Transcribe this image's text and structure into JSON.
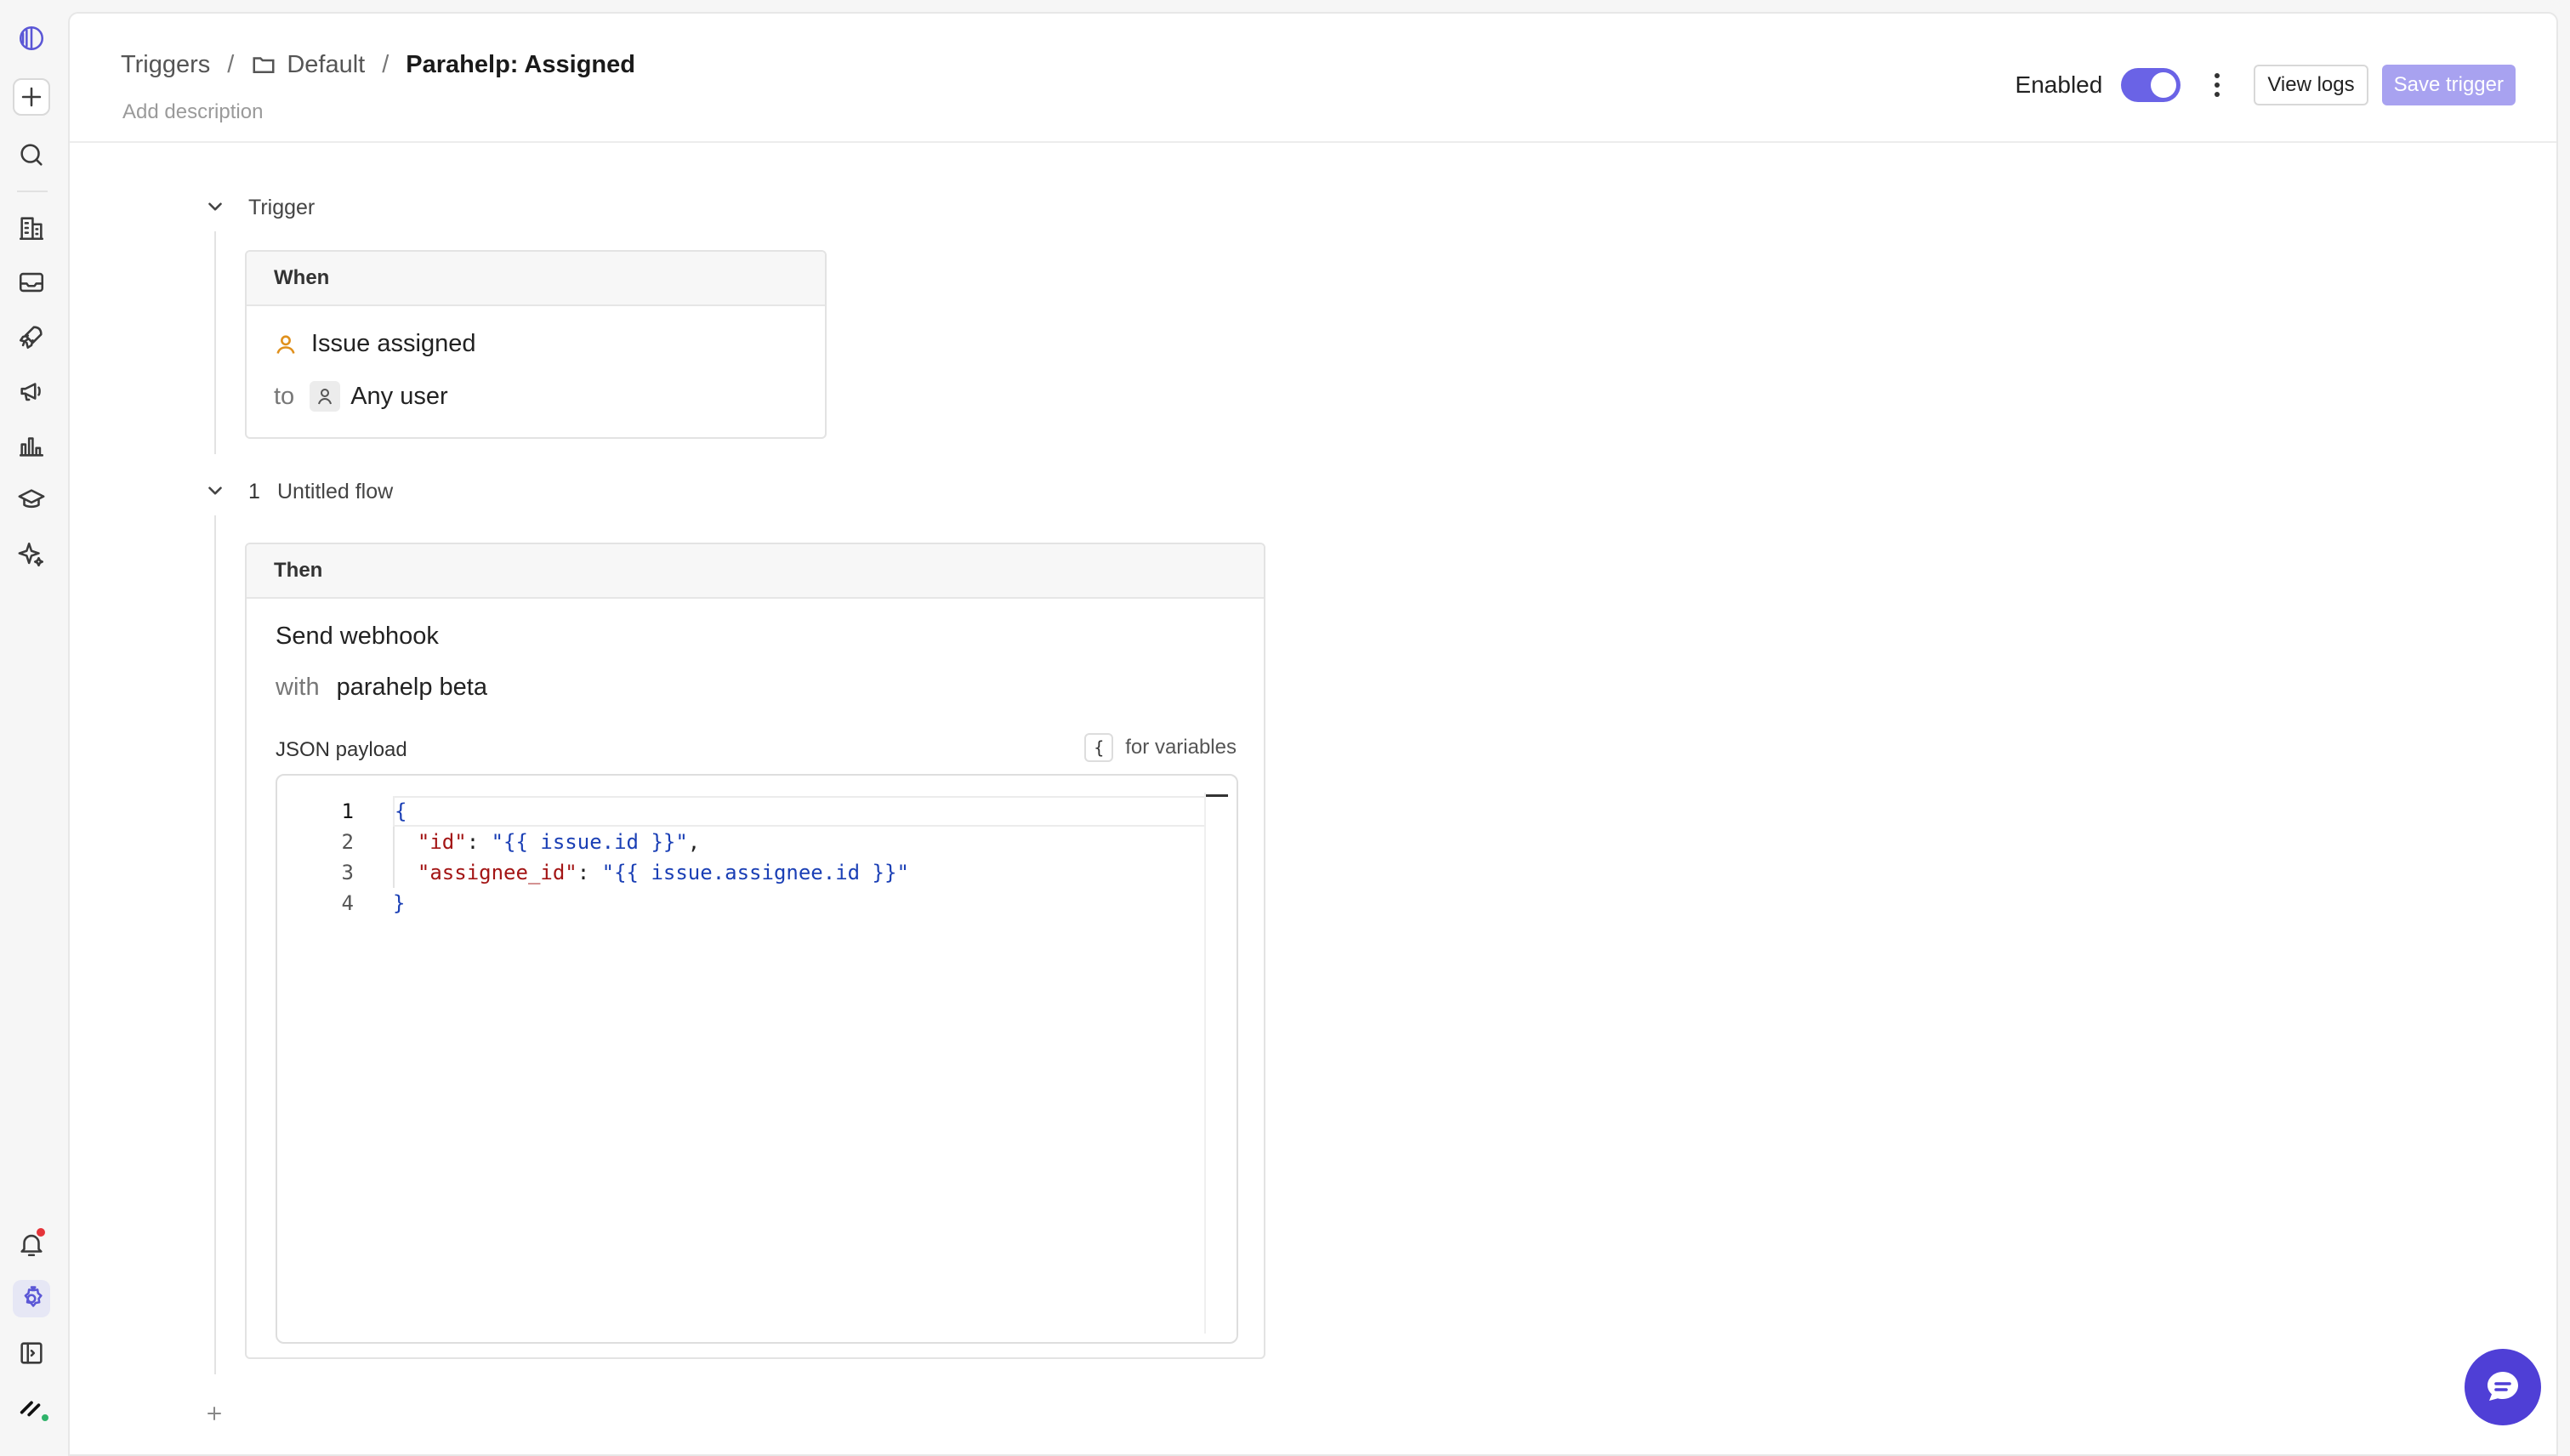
{
  "rail": {
    "items": [
      "logo",
      "new",
      "search",
      "buildings",
      "inbox",
      "rocket",
      "megaphone",
      "chart",
      "graduation",
      "sparkle",
      "notifications",
      "settings",
      "sidebar-toggle",
      "workspace"
    ]
  },
  "header": {
    "breadcrumb": {
      "root": "Triggers",
      "sep1": "/",
      "folder": "Default",
      "sep2": "/",
      "current": "Parahelp: Assigned"
    },
    "add_description": "Add description",
    "enabled_label": "Enabled",
    "enabled": true,
    "view_logs": "View logs",
    "save_trigger": "Save trigger"
  },
  "trigger": {
    "section_title": "Trigger",
    "card_header": "When",
    "event": "Issue assigned",
    "to_label": "to",
    "target": "Any user"
  },
  "flow": {
    "number": "1",
    "title": "Untitled flow",
    "card_header": "Then",
    "action": "Send webhook",
    "with_label": "with",
    "with_value": "parahelp beta",
    "payload_label": "JSON payload",
    "variables_key": "{",
    "variables_hint": "for variables",
    "code_lines": [
      "1",
      "2",
      "3",
      "4"
    ],
    "code": {
      "open_brace": "{",
      "line2_key": "\"id\"",
      "line2_colon": ": ",
      "line2_value": "\"{{ issue.id }}\"",
      "line2_comma": ",",
      "line3_key": "\"assignee_id\"",
      "line3_colon": ": ",
      "line3_value": "\"{{ issue.assignee.id }}\"",
      "close_brace": "}"
    }
  },
  "colors": {
    "accent": "#6a63e6",
    "save_button": "#a8a2f0",
    "chat_fab": "#4f3fd6"
  }
}
